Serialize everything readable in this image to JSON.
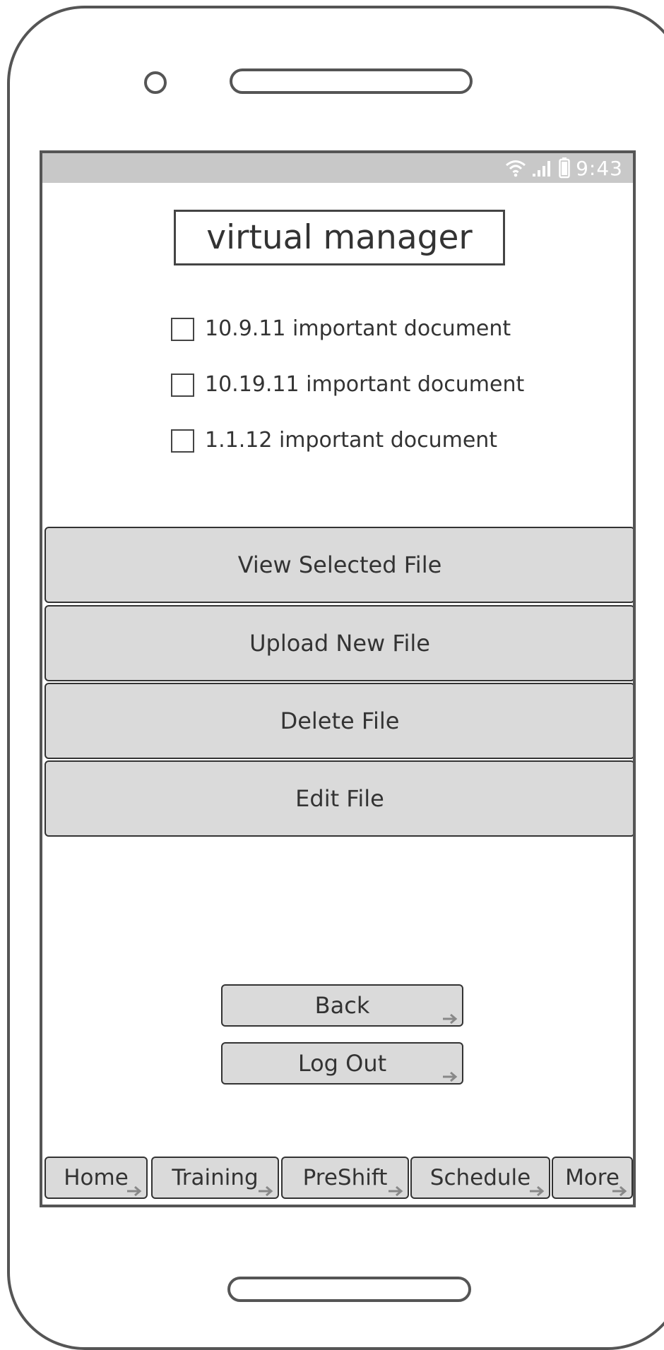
{
  "status_bar": {
    "time": "9:43",
    "icons": [
      "wifi-icon",
      "signal-icon",
      "battery-icon"
    ]
  },
  "app": {
    "title": "virtual manager"
  },
  "documents": [
    {
      "label": "10.9.11 important document",
      "checked": false
    },
    {
      "label": "10.19.11 important document",
      "checked": false
    },
    {
      "label": "1.1.12 important document",
      "checked": false
    }
  ],
  "actions": {
    "view": "View Selected File",
    "upload": "Upload New File",
    "delete": "Delete File",
    "edit": "Edit File"
  },
  "nav_buttons": {
    "back": "Back",
    "logout": "Log Out"
  },
  "tabs": [
    {
      "label": "Home"
    },
    {
      "label": "Training"
    },
    {
      "label": "PreShift"
    },
    {
      "label": "Schedule"
    },
    {
      "label": "More"
    }
  ],
  "colors": {
    "outline": "#555555",
    "status_bar": "#c8c8c8",
    "button_fill": "#dadada",
    "text": "#333333"
  }
}
